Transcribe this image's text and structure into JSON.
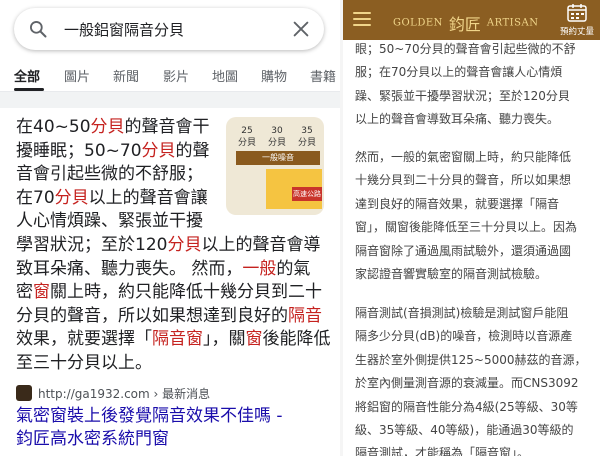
{
  "search": {
    "query": "一般鋁窗隔音分貝"
  },
  "tabs": [
    "全部",
    "圖片",
    "新聞",
    "影片",
    "地圖",
    "購物",
    "書籍"
  ],
  "snippet": {
    "lines": [
      [
        {
          "t": "在40~50"
        },
        {
          "t": "分貝",
          "h": true
        },
        {
          "t": "的聲音會干"
        }
      ],
      [
        {
          "t": "擾睡眠；50~70"
        },
        {
          "t": "分貝",
          "h": true
        },
        {
          "t": "的聲"
        }
      ],
      [
        {
          "t": "音會引起些微的不舒服；"
        }
      ],
      [
        {
          "t": "在70"
        },
        {
          "t": "分貝",
          "h": true
        },
        {
          "t": "以上的聲音會讓"
        }
      ],
      [
        {
          "t": "人心情煩躁、緊張並干擾"
        }
      ],
      [
        {
          "t": "學習狀況；至於120"
        },
        {
          "t": "分貝",
          "h": true
        },
        {
          "t": "以上的聲音會導"
        }
      ],
      [
        {
          "t": "致耳朵痛、聽力喪失。 然而，"
        },
        {
          "t": "一般",
          "h": true
        },
        {
          "t": "的氣"
        }
      ],
      [
        {
          "t": "密"
        },
        {
          "t": "窗",
          "h": true
        },
        {
          "t": "關上時，約只能降低十幾分貝到二十"
        }
      ],
      [
        {
          "t": "分貝的聲音，所以如果想達到良好的"
        },
        {
          "t": "隔音",
          "h": true
        }
      ],
      [
        {
          "t": "效果，就要選擇「"
        },
        {
          "t": "隔音窗",
          "h": true
        },
        {
          "t": "」，關"
        },
        {
          "t": "窗",
          "h": true
        },
        {
          "t": "後能降低"
        }
      ],
      [
        {
          "t": "至三十分貝以上。"
        }
      ]
    ]
  },
  "thumbnail": {
    "cols": [
      "25\n分貝",
      "30\n分貝",
      "35\n分貝"
    ],
    "band": "一般噪音",
    "tag": "高速公路"
  },
  "result": {
    "source": "http://ga1932.com › 最新消息",
    "title_lines": [
      "氣密窗裝上後發覺隔音效果不佳嗎 -",
      "鈞匠高水密系統門窗"
    ]
  },
  "site": {
    "brand_left": "GOLDEN",
    "brand_cn": "鈞匠",
    "brand_right": "ARTISAN",
    "booking": "預約丈量",
    "colors": {
      "bar": "#8b5e22",
      "gold": "#f0d58a"
    }
  },
  "article": {
    "para1": [
      "眼；50~70分貝的聲音會引起些微的不舒",
      "服；在70分貝以上的聲音會讓人心情煩",
      "躁、緊張並干擾學習狀況；至於120分貝",
      "以上的聲音會導致耳朵痛、聽力喪失。"
    ],
    "para2": [
      "然而，一般的氣密窗關上時，約只能降低",
      "十幾分貝到二十分貝的聲音，所以如果想",
      "達到良好的隔音效果，就要選擇「隔音",
      "窗」，關窗後能降低至三十分貝以上。因為",
      "隔音窗除了通過風雨試驗外，還須通過國",
      "家認證音響實驗室的隔音測試檢驗。"
    ],
    "para3": [
      "隔音測試(音損測試)檢驗是測試窗戶能阻",
      "隔多少分貝(dB)的噪音，檢測時以音源產",
      "生器於室外側提供125~5000赫茲的音源，",
      "於室內側量測音源的衰減量。而CNS3092",
      "將鋁窗的隔音性能分為4級(25等級、30等",
      "級、35等級、40等級)，能通過30等級的",
      "隔音測試，才能稱為「隔音窗」。"
    ]
  }
}
